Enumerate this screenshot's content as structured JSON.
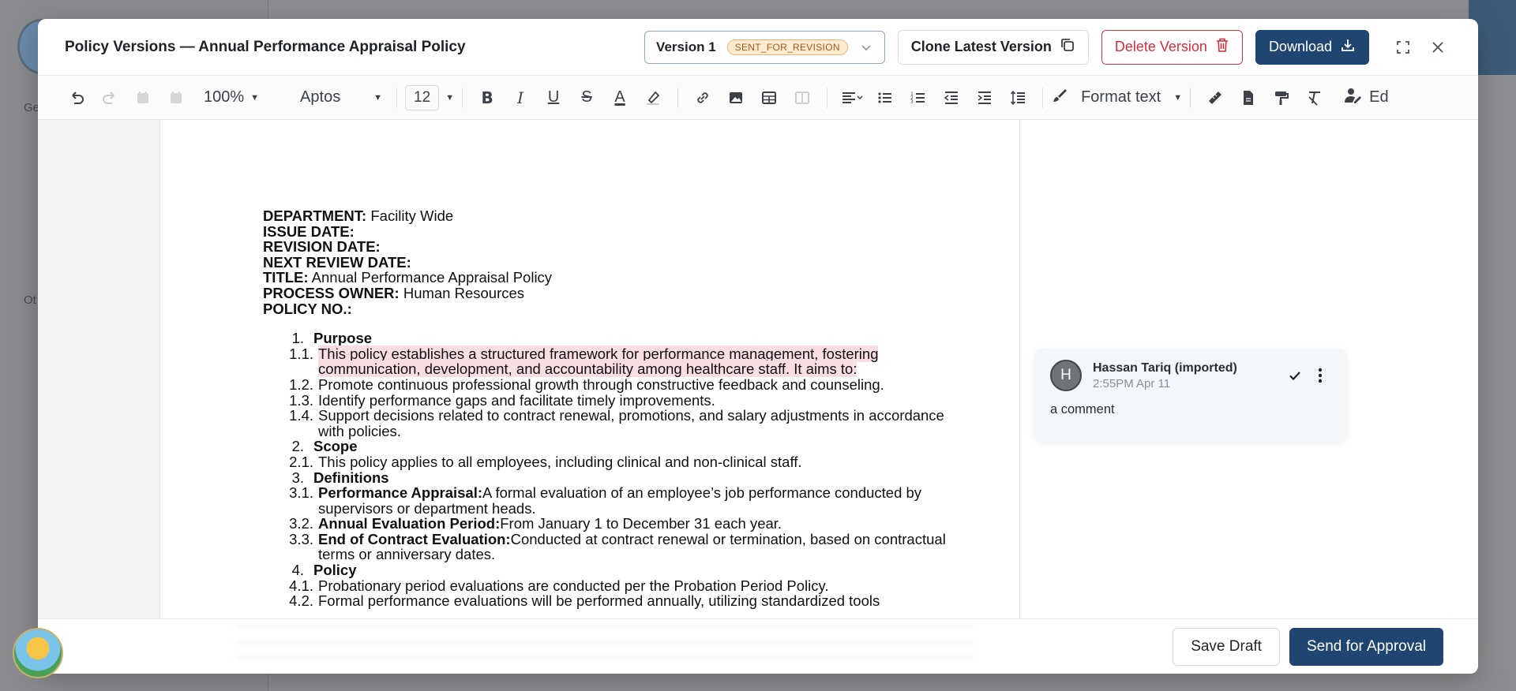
{
  "background": {
    "sidebar_labels": [
      "Ge",
      "Ot"
    ]
  },
  "modal": {
    "title": "Policy Versions — Annual Performance Appraisal Policy",
    "version": {
      "label": "Version 1",
      "status": "SENT_FOR_REVISION"
    },
    "buttons": {
      "clone": "Clone Latest Version",
      "delete": "Delete Version",
      "download": "Download"
    }
  },
  "toolbar": {
    "zoom": "100%",
    "font": "Aptos",
    "font_size": "12",
    "format_text": "Format text",
    "edit_partial": "Ed"
  },
  "document": {
    "meta": [
      {
        "label": "DEPARTMENT:",
        "value": " Facility Wide"
      },
      {
        "label": "ISSUE DATE:",
        "value": ""
      },
      {
        "label": "REVISION DATE:",
        "value": ""
      },
      {
        "label": "NEXT REVIEW DATE:",
        "value": ""
      },
      {
        "label": "TITLE:",
        "value": " Annual Performance Appraisal Policy"
      },
      {
        "label": "PROCESS OWNER:",
        "value": " Human Resources"
      },
      {
        "label": "POLICY NO.:",
        "value": ""
      }
    ],
    "items": [
      {
        "num": "1.",
        "text": "Purpose",
        "section": true
      },
      {
        "num": "1.1.",
        "text": "This policy establishes a structured framework for performance management, fostering communication, development, and accountability among healthcare staff. It aims to:",
        "highlight": true
      },
      {
        "num": "1.2.",
        "text": "Promote continuous professional growth through constructive feedback and counseling."
      },
      {
        "num": "1.3.",
        "text": "Identify performance gaps and facilitate timely improvements."
      },
      {
        "num": "1.4.",
        "text": "Support decisions related to contract renewal, promotions, and salary adjustments in accordance with policies."
      },
      {
        "num": "2.",
        "text": "Scope",
        "section": true
      },
      {
        "num": "2.1.",
        "text": "This policy applies to all employees, including clinical and non-clinical staff."
      },
      {
        "num": "3.",
        "text": "Definitions",
        "section": true
      },
      {
        "num": "3.1.",
        "bold": "Performance Appraisal:",
        "text": "A formal evaluation of an employee’s job performance conducted by supervisors or department heads."
      },
      {
        "num": "3.2.",
        "bold": "Annual Evaluation Period:",
        "text": "From January 1 to December 31 each year."
      },
      {
        "num": "3.3.",
        "bold": "End of Contract Evaluation:",
        "text": "Conducted at contract renewal or termination, based on contractual terms or anniversary dates."
      },
      {
        "num": "4.",
        "text": "Policy",
        "section": true
      },
      {
        "num": "4.1.",
        "text": "Probationary period evaluations are conducted per the Probation Period Policy."
      },
      {
        "num": "4.2.",
        "text": "Formal performance evaluations will be performed annually, utilizing standardized tools"
      }
    ]
  },
  "comment": {
    "avatar_initial": "H",
    "author": "Hassan Tariq (imported)",
    "time": "2:55PM Apr 11",
    "text": "a comment"
  },
  "footer": {
    "save_draft": "Save Draft",
    "send_for_approval": "Send for Approval"
  },
  "colors": {
    "primary": "#1f4670",
    "danger": "#d42d3b",
    "highlight": "#f8dde3",
    "status_badge_bg": "#fdecd2"
  }
}
